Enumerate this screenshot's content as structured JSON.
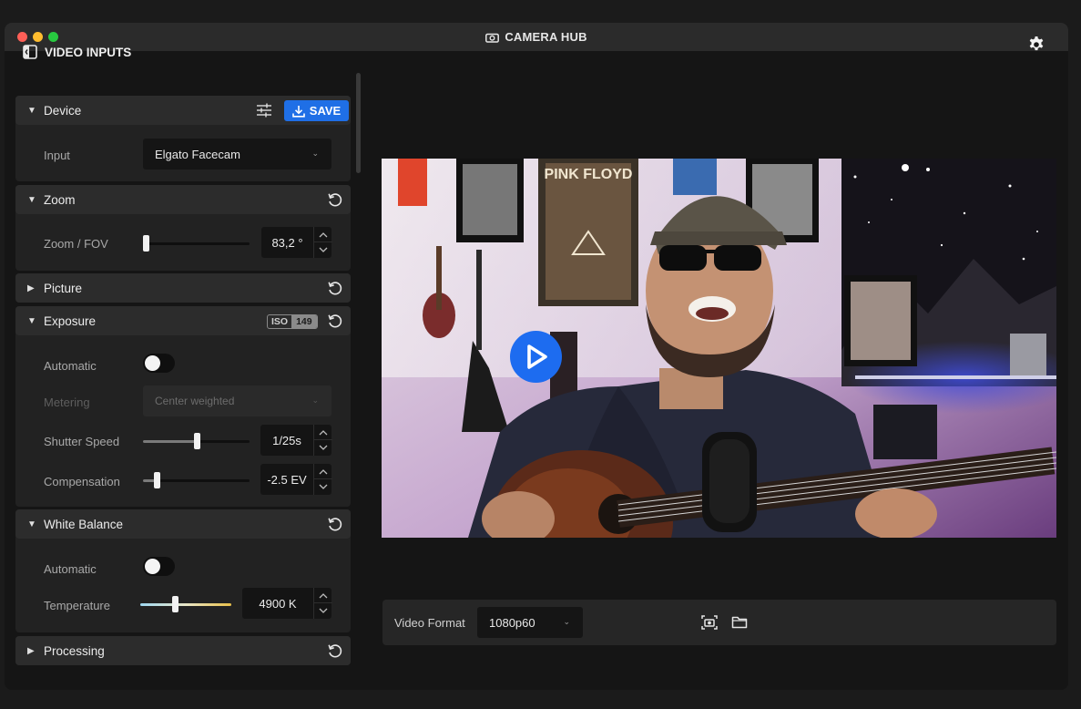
{
  "window": {
    "title": "CAMERA HUB"
  },
  "panel": {
    "title": "VIDEO INPUTS"
  },
  "device": {
    "label": "Device",
    "save_label": "SAVE",
    "input_label": "Input",
    "input_value": "Elgato Facecam"
  },
  "zoom": {
    "label": "Zoom",
    "fov_label": "Zoom / FOV",
    "fov_value": "83,2 °",
    "slider_level": 0.0
  },
  "picture": {
    "label": "Picture"
  },
  "exposure": {
    "label": "Exposure",
    "iso_key": "ISO",
    "iso_value": "149",
    "automatic_label": "Automatic",
    "automatic_on": false,
    "metering_label": "Metering",
    "metering_value": "Center weighted",
    "shutter_label": "Shutter Speed",
    "shutter_value": "1/25s",
    "shutter_level": 0.5,
    "compensation_label": "Compensation",
    "compensation_value": "-2.5 EV",
    "compensation_level": 0.13
  },
  "white_balance": {
    "label": "White Balance",
    "automatic_label": "Automatic",
    "automatic_on": false,
    "temperature_label": "Temperature",
    "temperature_value": "4900 K",
    "temperature_level": 0.38
  },
  "processing": {
    "label": "Processing"
  },
  "bottom": {
    "format_label": "Video Format",
    "format_value": "1080p60"
  },
  "colors": {
    "accent": "#1f6fe6",
    "play": "#1d6cf0",
    "background": "#151515",
    "section": "#222222"
  },
  "icons": [
    "camera-icon",
    "sidebar-icon",
    "gear-icon",
    "tune-icon",
    "download-icon",
    "reset-icon",
    "play-icon",
    "screenshot-icon",
    "folder-icon"
  ]
}
